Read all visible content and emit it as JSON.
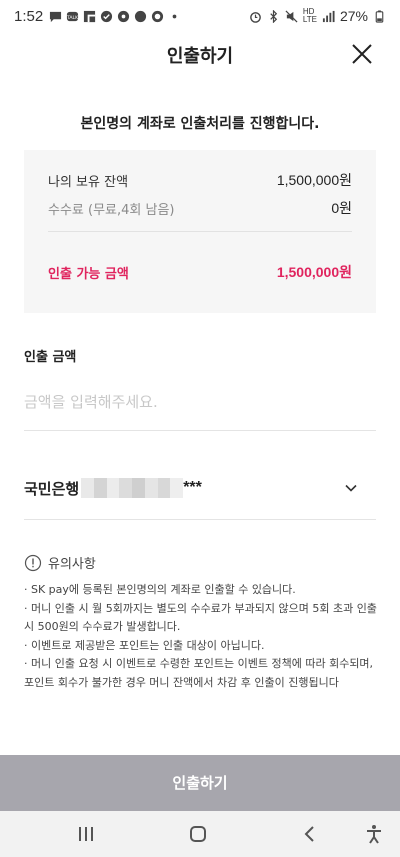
{
  "status_bar": {
    "time": "1:52",
    "network_label_top": "HD",
    "network_label_bottom": "LTE",
    "battery_percent": "27%"
  },
  "header": {
    "title": "인출하기",
    "close_icon": "close-icon"
  },
  "notice_heading": "본인명의 계좌로 인출처리를 진행합니다.",
  "balance": {
    "my_balance_label": "나의 보유 잔액",
    "my_balance_value": "1,500,000원",
    "fee_label": "수수료 (무료,4회 남음)",
    "fee_value": "0원",
    "available_label": "인출 가능 금액",
    "available_value": "1,500,000원",
    "available_color": "#e0245e"
  },
  "amount": {
    "label": "인출 금액",
    "value": "",
    "placeholder": "금액을 입력해주세요."
  },
  "bank": {
    "name": "국민은행",
    "masked_suffix": "***",
    "chevron_icon": "chevron-down-icon"
  },
  "caution": {
    "title": "유의사항",
    "icon": "exclamation-circle-icon",
    "items": [
      "· SK pay에 등록된 본인명의의 계좌로 인출할 수 있습니다.",
      "· 머니 인출 시 월 5회까지는 별도의 수수료가 부과되지 않으며 5회 초과 인출 시 500원의 수수료가 발생합니다.",
      "· 이벤트로 제공받은 포인트는 인출 대상이 아닙니다.",
      "· 머니 인출 요청 시 이벤트로 수령한 포인트는 이벤트 정책에 따라 회수되며, 포인트 회수가 불가한 경우 머니 잔액에서 차감 후 인출이 진행됩니다"
    ]
  },
  "submit_label": "인출하기",
  "submit_color": "#a7a6ad",
  "nav_bar": {
    "recents_icon": "recents-icon",
    "home_icon": "home-icon",
    "back_icon": "back-icon",
    "accessibility_icon": "accessibility-icon"
  }
}
